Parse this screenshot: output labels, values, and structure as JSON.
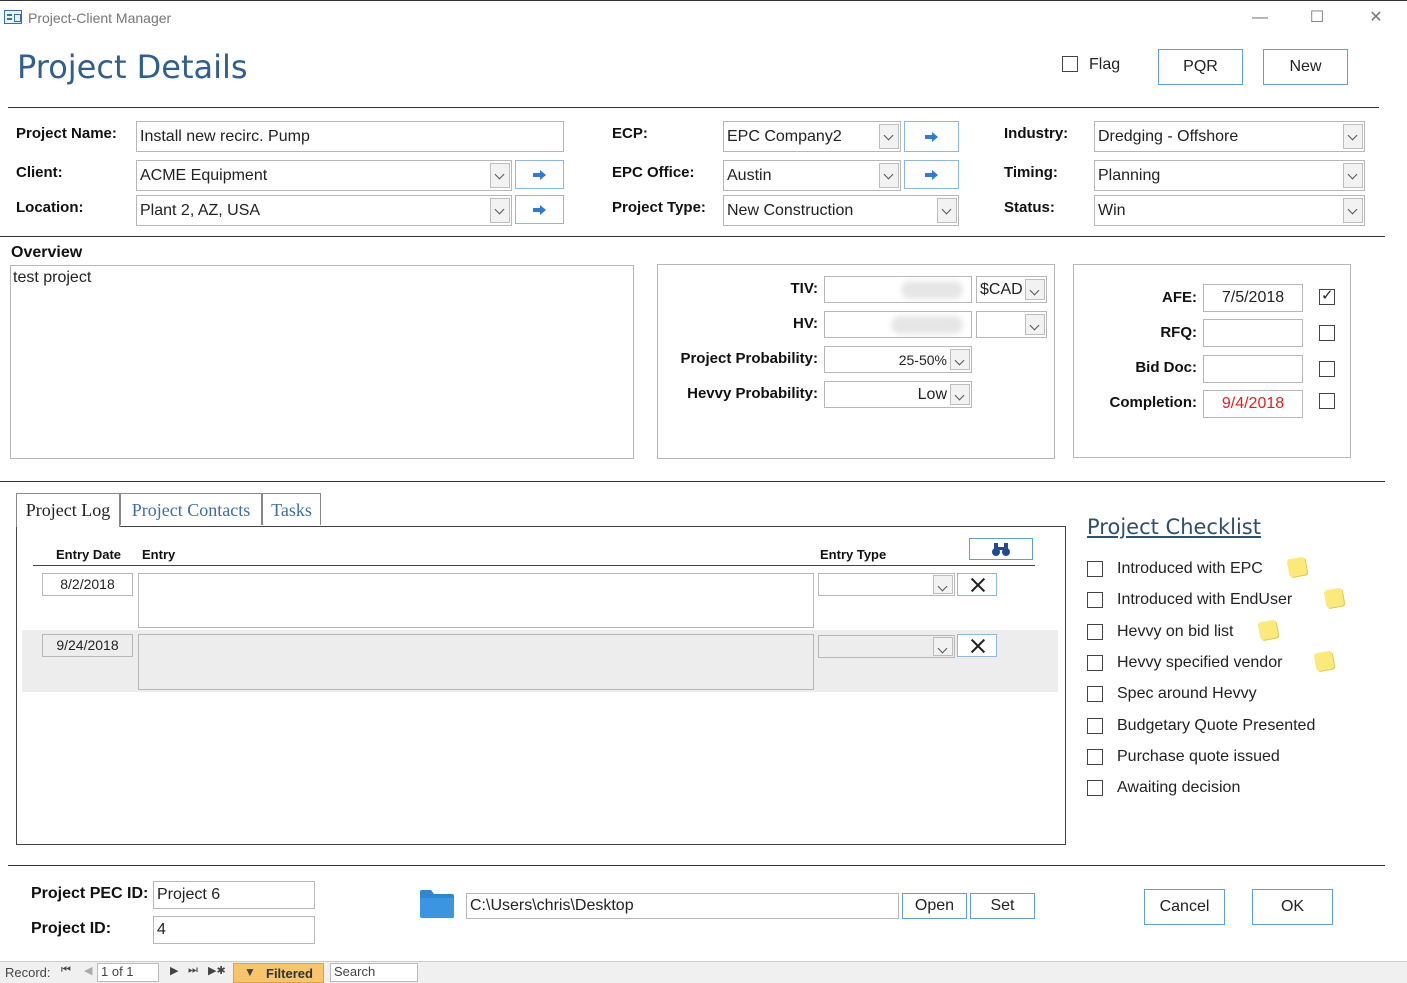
{
  "window": {
    "title": "Project-Client Manager",
    "minimize": "—",
    "maximize": "☐",
    "close": "✕"
  },
  "header": {
    "title": "Project Details",
    "flag_label": "Flag",
    "pqr_label": "PQR",
    "new_label": "New"
  },
  "fields": {
    "project_name_label": "Project Name:",
    "project_name": "Install new recirc. Pump",
    "client_label": "Client:",
    "client": "ACME Equipment",
    "location_label": "Location:",
    "location": "Plant 2, AZ, USA",
    "ecp_label": "ECP:",
    "ecp": "EPC Company2",
    "epc_office_label": "EPC Office:",
    "epc_office": "Austin",
    "project_type_label": "Project Type:",
    "project_type": "New Construction",
    "industry_label": "Industry:",
    "industry": "Dredging - Offshore",
    "timing_label": "Timing:",
    "timing": "Planning",
    "status_label": "Status:",
    "status": "Win"
  },
  "overview": {
    "label": "Overview",
    "text": "test project"
  },
  "values": {
    "tiv_label": "TIV:",
    "tiv_currency": "$CAD",
    "hv_label": "HV:",
    "hv_currency": "",
    "project_probability_label": "Project Probability:",
    "project_probability": "25-50%",
    "hevvy_probability_label": "Hevvy Probability:",
    "hevvy_probability": "Low"
  },
  "dates": {
    "afe_label": "AFE:",
    "afe": "7/5/2018",
    "afe_checked": true,
    "rfq_label": "RFQ:",
    "rfq": "",
    "rfq_checked": false,
    "bid_doc_label": "Bid Doc:",
    "bid_doc": "",
    "bid_doc_checked": false,
    "completion_label": "Completion:",
    "completion": "9/4/2018",
    "completion_checked": false,
    "completion_color": "#e02020"
  },
  "tabs": [
    {
      "label": "Project Log",
      "active": true
    },
    {
      "label": "Project Contacts",
      "active": false
    },
    {
      "label": "Tasks",
      "active": false
    }
  ],
  "log": {
    "columns": {
      "entry_date": "Entry Date",
      "entry": "Entry",
      "entry_type": "Entry Type"
    },
    "rows": [
      {
        "date": "8/2/2018",
        "entry": "",
        "type": ""
      },
      {
        "date": "9/24/2018",
        "entry": "",
        "type": ""
      }
    ]
  },
  "checklist": {
    "title": "Project Checklist",
    "items": [
      {
        "label": "Introduced with EPC",
        "checked": false,
        "note": true
      },
      {
        "label": "Introduced with EndUser",
        "checked": false,
        "note": true
      },
      {
        "label": "Hevvy on bid list",
        "checked": false,
        "note": true
      },
      {
        "label": "Hevvy specified vendor",
        "checked": false,
        "note": true
      },
      {
        "label": "Spec around Hevvy",
        "checked": false,
        "note": false
      },
      {
        "label": "Budgetary Quote Presented",
        "checked": false,
        "note": false
      },
      {
        "label": "Purchase quote issued",
        "checked": false,
        "note": false
      },
      {
        "label": "Awaiting decision",
        "checked": false,
        "note": false
      }
    ]
  },
  "footer": {
    "pec_id_label": "Project PEC ID:",
    "pec_id": "Project 6",
    "project_id_label": "Project ID:",
    "project_id": "4",
    "folder_path": "C:\\Users\\chris\\Desktop",
    "open_label": "Open",
    "set_label": "Set",
    "cancel_label": "Cancel",
    "ok_label": "OK"
  },
  "navigation": {
    "record_label": "Record:",
    "position": "1 of 1",
    "filter_label": "Filtered",
    "search_label": "Search"
  },
  "colors": {
    "title_blue": "#2f5f8f",
    "accent_blue": "#5f9ed6",
    "tab_link": "#3a6ea5"
  }
}
